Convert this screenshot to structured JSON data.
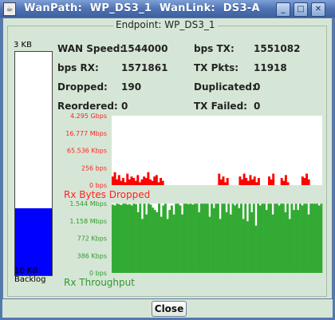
{
  "window": {
    "title": "WanPath:  WP_DS3_1  WanLink:  DS3-A",
    "icon": "java-coffee-icon",
    "controls": [
      "minimize-icon",
      "maximize-icon",
      "close-icon"
    ]
  },
  "group_title": "Endpoint: WP_DS3_1",
  "backlog": {
    "top_label": "3 KB",
    "bottom_label": "10 KB",
    "caption": "Backlog",
    "fill_fraction": 0.3,
    "fill_color": "#0000ff"
  },
  "stats": {
    "wan_speed_label": "WAN Speed:",
    "wan_speed_value": "1544000",
    "bps_tx_label": "bps TX:",
    "bps_tx_value": "1551082",
    "bps_rx_label": "bps RX:",
    "bps_rx_value": "1571861",
    "tx_pkts_label": "TX Pkts:",
    "tx_pkts_value": "11918",
    "dropped_label": "Dropped:",
    "dropped_value": "190",
    "duplicated_label": "Duplicated:",
    "duplicated_value": "0",
    "reordered_label": "Reordered:",
    "reordered_value": "0",
    "tx_failed_label": "TX Failed:",
    "tx_failed_value": "0"
  },
  "chart_data": [
    {
      "type": "bar",
      "title": "Rx Bytes Dropped",
      "color": "#ff0000",
      "y_ticks": [
        "4.295 Gbps",
        "16.777 Mbps",
        "65.536 Kbps",
        "256 bps",
        "0 bps"
      ],
      "scale": "log",
      "values": [
        0,
        0,
        0,
        0,
        0,
        0,
        0,
        0,
        0,
        0,
        0,
        0,
        0,
        0,
        0,
        0,
        0,
        0,
        0,
        0,
        0,
        0,
        0,
        0,
        0,
        0,
        0,
        0,
        0,
        0,
        0,
        0,
        0,
        0,
        0,
        0,
        0,
        0,
        0,
        0,
        0,
        0,
        0,
        0,
        0,
        0,
        0,
        0,
        0,
        0,
        0,
        0,
        0,
        0,
        0,
        0,
        0,
        0,
        0,
        0,
        0,
        0,
        0,
        0,
        0,
        0,
        0,
        0,
        0,
        0,
        0,
        0,
        0,
        0,
        0,
        0,
        0,
        0,
        0,
        0,
        0,
        0,
        0,
        0,
        0,
        0,
        0,
        0,
        0,
        0,
        0,
        0,
        0,
        0,
        0,
        0,
        0,
        0,
        0,
        0
      ]
    },
    {
      "type": "bar",
      "title": "Rx Throughput",
      "color": "#33aa33",
      "y_ticks": [
        "1.544 Mbps",
        "1.158 Mbps",
        "772 Kbps",
        "386 Kbps",
        "0 bps"
      ],
      "values": [
        1.52,
        1.5,
        1.54,
        1.53,
        1.51,
        1.54,
        1.54,
        1.52,
        1.53,
        1.5,
        1.54,
        1.53,
        1.35,
        1.54,
        1.2,
        1.54,
        1.3,
        1.54,
        1.52,
        1.45,
        1.4,
        1.35,
        1.54,
        1.25,
        1.5,
        1.54,
        1.2,
        1.4,
        1.5,
        1.3,
        1.54,
        1.54,
        1.5,
        1.3,
        1.54,
        1.54,
        1.53,
        1.54,
        1.52,
        1.54,
        1.54,
        1.35,
        1.54,
        1.54,
        1.54,
        1.54,
        1.25,
        1.54,
        1.44,
        1.54,
        1.54,
        1.2,
        1.54,
        1.54,
        1.35,
        1.54,
        1.3,
        1.54,
        1.5,
        1.54,
        1.44,
        1.54,
        1.2,
        1.54,
        1.15,
        1.54,
        1.35,
        1.54,
        1.05,
        1.54,
        1.5,
        1.54,
        1.54,
        1.4,
        1.54,
        1.54,
        1.3,
        1.54,
        1.54,
        1.5,
        1.54,
        1.54,
        1.35,
        1.54,
        1.2,
        1.54,
        1.4,
        1.54,
        1.4,
        1.54,
        1.5,
        1.54,
        1.54,
        1.3,
        1.54,
        1.54,
        1.54,
        1.54,
        1.5,
        1.54
      ]
    }
  ]
}
